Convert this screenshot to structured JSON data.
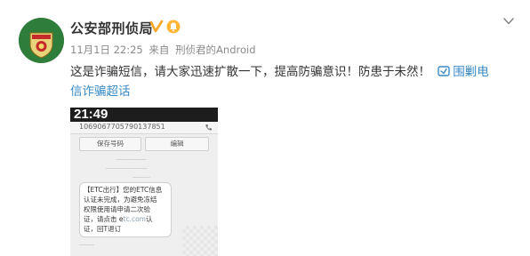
{
  "post": {
    "author": "公安部刑侦局",
    "badges": {
      "verified": "verified-v-icon",
      "member": "member-bell-icon"
    },
    "time": "11月1日 22:25",
    "via_prefix": "来自",
    "via_app": "刑侦君的Android",
    "text_lines": [
      "这是诈骗短信，请大家迅速扩散一下，提高防骗意识！防患于未然！",
      "信诈骗超话"
    ],
    "topic_link_first": "围剿电",
    "topic_link_second": "信诈骗超话"
  },
  "avatar": {
    "emblem": "police-badge-icon",
    "color": "#2f7d3a"
  },
  "phone_screenshot": {
    "status_time": "21:49",
    "sender_number": "1069067705790137851",
    "buttons": {
      "save": "保存号码",
      "edit": "编辑"
    },
    "sms_lines": [
      "【ETC出行】您的ETC信息",
      "认证未完成，为避免冻结",
      "权限使用请申请二次验",
      "证，请点击 e",
      "认",
      "证，回T退订"
    ],
    "sms_blurred_url": "tc.com"
  },
  "colors": {
    "link": "#3a8ac6",
    "meta": "#8a8a8a",
    "text": "#333333"
  }
}
